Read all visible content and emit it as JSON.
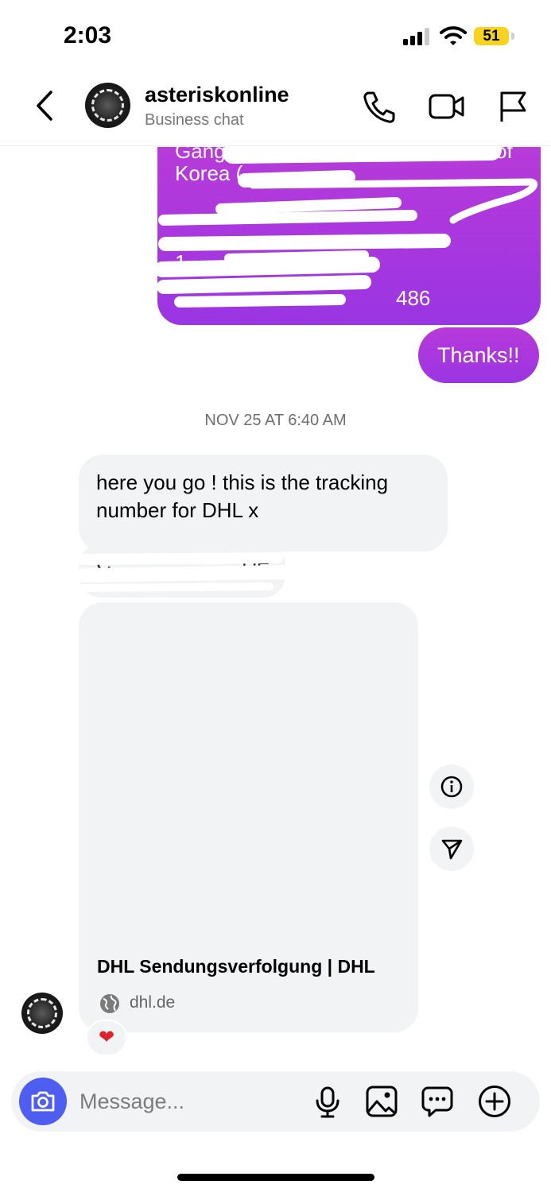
{
  "status_bar": {
    "time": "2:03",
    "battery": "51"
  },
  "header": {
    "contact_name": "asteriskonline",
    "subtitle": "Business chat"
  },
  "messages": {
    "address_lines": [
      "Gangu",
      "Korea (",
      "1",
      "486",
      "of"
    ],
    "thanks": "Thanks!!",
    "timestamp": "NOV 25 AT 6:40 AM",
    "text1": "here you go ! this is the tracking number for DHL x",
    "tracking_fragments": [
      "C",
      "DE"
    ],
    "link_card": {
      "title": "DHL Sendungsverfolgung | DHL",
      "domain": "dhl.de"
    },
    "reaction": "❤"
  },
  "composer": {
    "placeholder": "Message..."
  },
  "colors": {
    "accent_purple": "#9a35e3",
    "camera_blue": "#4d5ef0",
    "battery_yellow": "#f7d41b"
  }
}
